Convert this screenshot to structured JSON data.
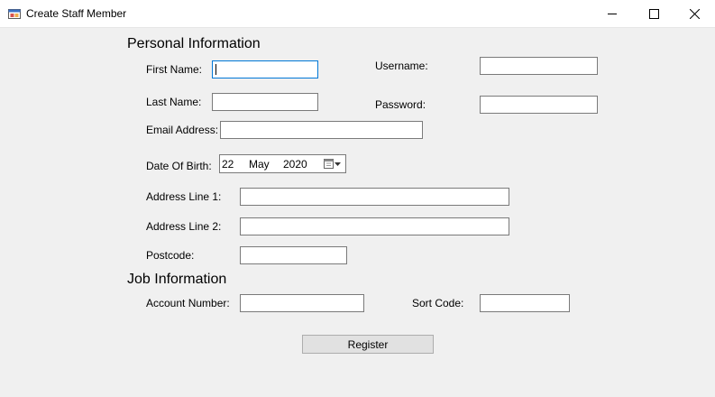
{
  "window": {
    "title": "Create Staff Member"
  },
  "personal": {
    "header": "Personal Information",
    "first_name_label": "First Name:",
    "last_name_label": "Last Name:",
    "username_label": "Username:",
    "password_label": "Password:",
    "email_label": "Email Address:",
    "dob_label": "Date Of Birth:",
    "dob": {
      "day": "22",
      "month": "May",
      "year": "2020"
    },
    "address1_label": "Address Line 1:",
    "address2_label": "Address Line 2:",
    "postcode_label": "Postcode:"
  },
  "job": {
    "header": "Job Information",
    "account_label": "Account Number:",
    "sort_code_label": "Sort Code:"
  },
  "actions": {
    "register_label": "Register"
  },
  "colors": {
    "focus_border": "#0078d7",
    "window_bg": "#f0f0f0",
    "button_bg": "#e1e1e1"
  },
  "icons": [
    "app-icon",
    "minimize-icon",
    "maximize-icon",
    "close-icon",
    "calendar-icon",
    "dropdown-arrow-icon"
  ]
}
